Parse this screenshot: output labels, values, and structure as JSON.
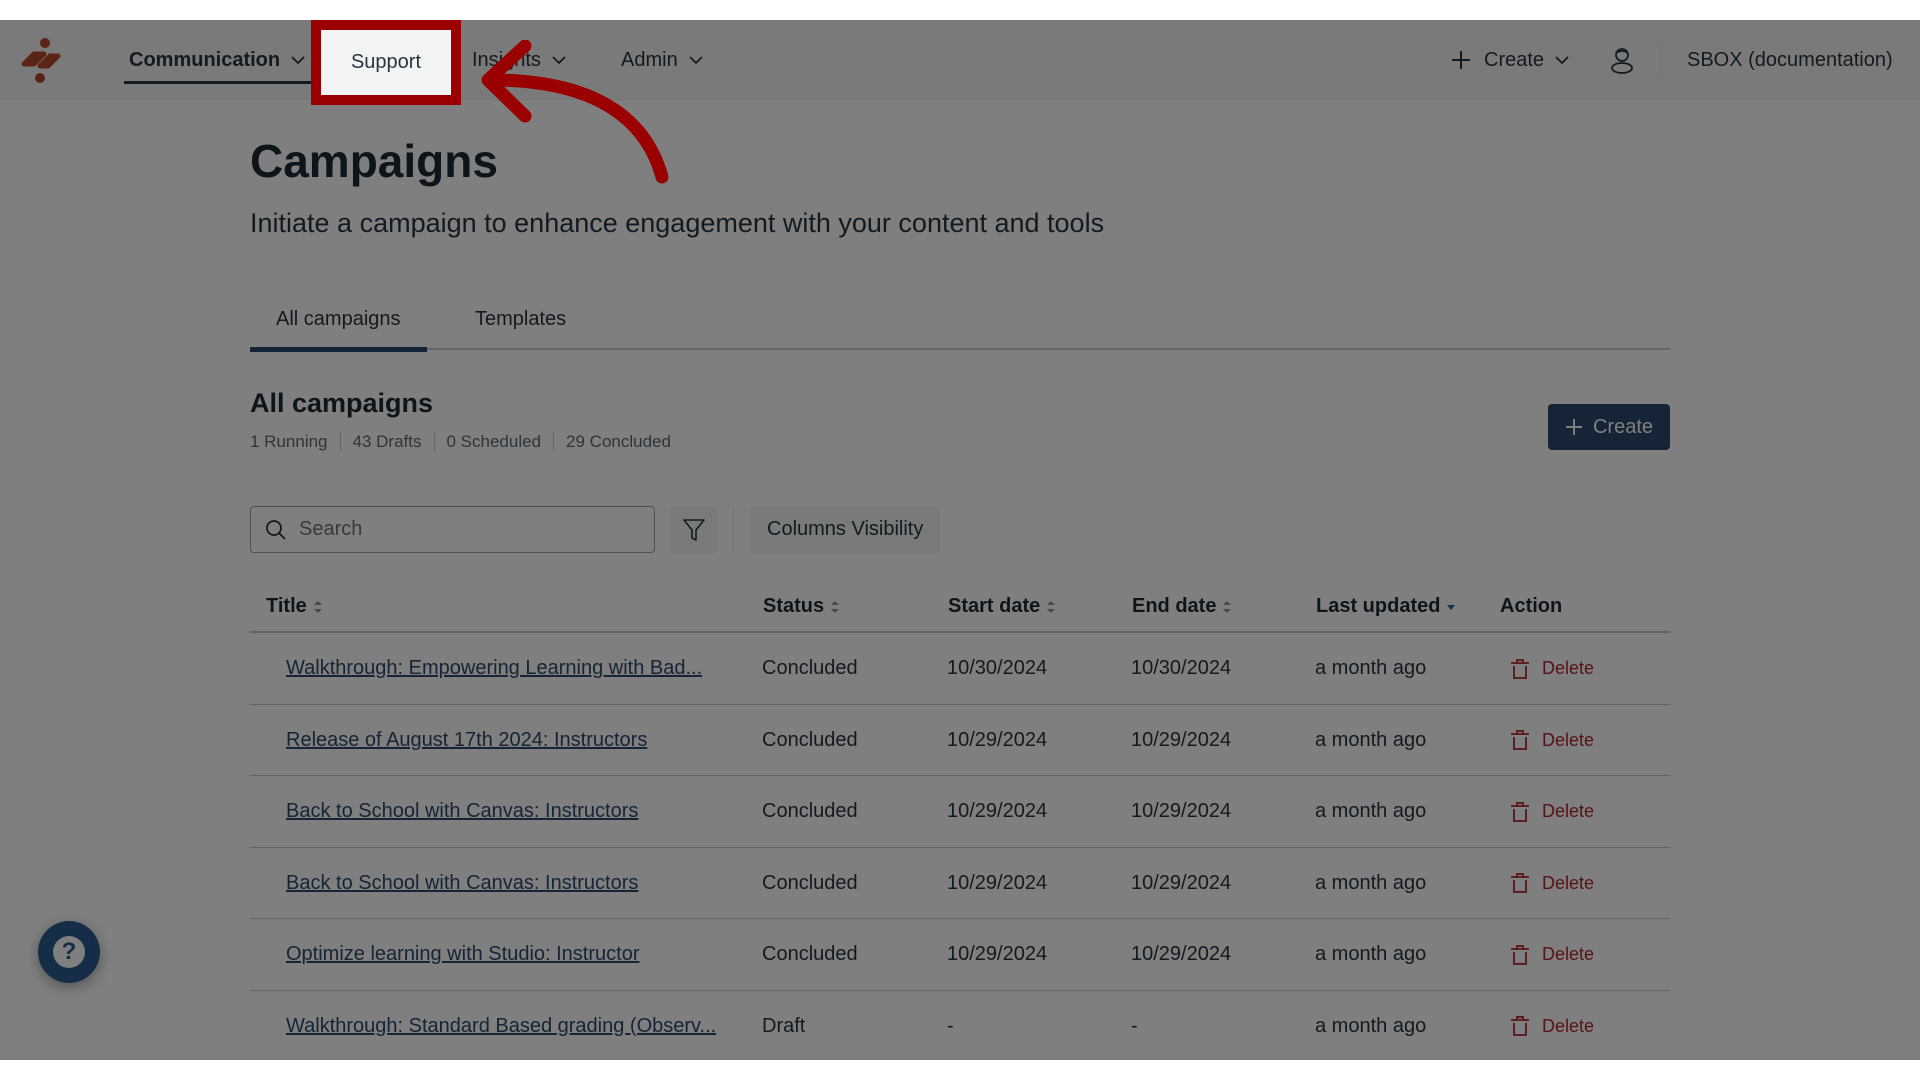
{
  "nav": {
    "items": [
      {
        "label": "Communication",
        "active": true,
        "has_dropdown": true
      },
      {
        "label": "Support",
        "active": false,
        "has_dropdown": false
      },
      {
        "label": "Insights",
        "active": false,
        "has_dropdown": true
      },
      {
        "label": "Admin",
        "active": false,
        "has_dropdown": true
      }
    ],
    "create_label": "Create",
    "account_label": "SBOX (documentation)",
    "icons": {
      "logo": "brand-logo",
      "user": "user-icon",
      "plus": "plus-icon",
      "chevron": "chevron-down-icon"
    }
  },
  "page": {
    "title": "Campaigns",
    "subtitle": "Initiate a campaign to enhance engagement with your content and tools"
  },
  "tabs": [
    {
      "label": "All campaigns",
      "active": true
    },
    {
      "label": "Templates",
      "active": false
    }
  ],
  "section": {
    "title": "All campaigns",
    "stats": [
      "1 Running",
      "43 Drafts",
      "0 Scheduled",
      "29 Concluded"
    ],
    "create_label": "Create"
  },
  "toolbar": {
    "search_placeholder": "Search",
    "search_value": "",
    "columns_visibility_label": "Columns Visibility"
  },
  "table": {
    "columns": [
      {
        "label": "Title",
        "sort": "none"
      },
      {
        "label": "Status",
        "sort": "none"
      },
      {
        "label": "Start date",
        "sort": "none"
      },
      {
        "label": "End date",
        "sort": "none"
      },
      {
        "label": "Last updated",
        "sort": "desc"
      },
      {
        "label": "Action",
        "sort": null
      }
    ],
    "rows": [
      {
        "title": "Walkthrough: Empowering Learning with Bad...",
        "status": "Concluded",
        "start": "10/30/2024",
        "end": "10/30/2024",
        "updated": "a month ago",
        "action": "Delete"
      },
      {
        "title": "Release of August 17th 2024: Instructors",
        "status": "Concluded",
        "start": "10/29/2024",
        "end": "10/29/2024",
        "updated": "a month ago",
        "action": "Delete"
      },
      {
        "title": "Back to School with Canvas: Instructors",
        "status": "Concluded",
        "start": "10/29/2024",
        "end": "10/29/2024",
        "updated": "a month ago",
        "action": "Delete"
      },
      {
        "title": "Back to School with Canvas: Instructors",
        "status": "Concluded",
        "start": "10/29/2024",
        "end": "10/29/2024",
        "updated": "a month ago",
        "action": "Delete"
      },
      {
        "title": "Optimize learning with Studio: Instructor",
        "status": "Concluded",
        "start": "10/29/2024",
        "end": "10/29/2024",
        "updated": "a month ago",
        "action": "Delete"
      },
      {
        "title": "Walkthrough: Standard Based grading (Observ...",
        "status": "Draft",
        "start": "-",
        "end": "-",
        "updated": "a month ago",
        "action": "Delete"
      }
    ]
  },
  "help_button": {
    "icon": "question-icon",
    "label": "?"
  },
  "annotation": {
    "highlight_label": "Support",
    "color": "#9b0000"
  },
  "colors": {
    "brand": "#b5482d",
    "primary": "#2b4a6e",
    "danger": "#b0262a",
    "overlay": "rgba(0,0,0,0.5)"
  }
}
